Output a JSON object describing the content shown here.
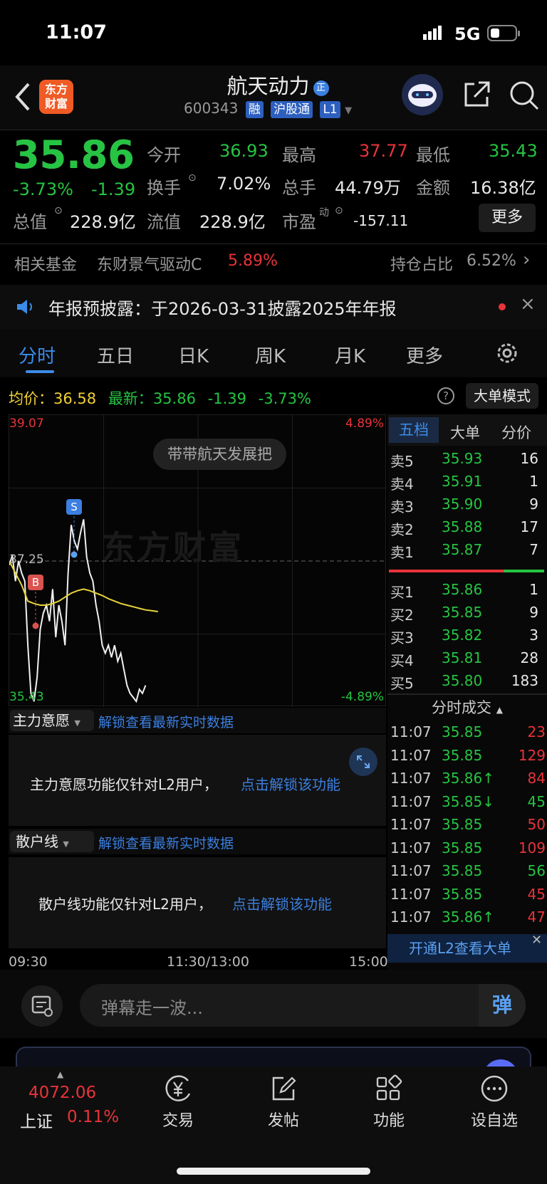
{
  "status": {
    "time": "11:07",
    "network": "5G"
  },
  "header": {
    "name": "航天动力",
    "badge": "正",
    "code": "600343",
    "tags": [
      "融",
      "沪股通",
      "L1"
    ]
  },
  "brand": {
    "logo_line1": "东方",
    "logo_line2": "财富"
  },
  "quote": {
    "price": "35.86",
    "pct": "-3.73%",
    "chg": "-1.39",
    "rows": [
      [
        {
          "k": "今开",
          "v": "36.93",
          "c": "green"
        },
        {
          "k": "最高",
          "v": "37.77",
          "c": "red"
        },
        {
          "k": "最低",
          "v": "35.43",
          "c": "green"
        }
      ],
      [
        {
          "k": "换手",
          "v": "7.02%",
          "c": "white"
        },
        {
          "k": "总手",
          "v": "44.79万",
          "c": "white"
        },
        {
          "k": "金额",
          "v": "16.38亿",
          "c": "white"
        }
      ],
      [
        {
          "k": "总值",
          "v": "228.9亿",
          "c": "white"
        },
        {
          "k": "流值",
          "v": "228.9亿",
          "c": "white"
        },
        {
          "k": "市盈",
          "v": "-157.11",
          "c": "white"
        }
      ]
    ],
    "more": "更多",
    "pe_sup": "动"
  },
  "fund": {
    "label": "相关基金",
    "name": "东财景气驱动C",
    "pct": "5.89%",
    "hold_label": "持仓占比",
    "hold": "6.52%"
  },
  "notice": {
    "text": "年报预披露：于2026-03-31披露2025年年报"
  },
  "tabs": [
    "分时",
    "五日",
    "日K",
    "周K",
    "月K",
    "更多"
  ],
  "info": {
    "avg_label": "均价：",
    "avg": "36.58",
    "last_label": "最新：",
    "last": "35.86",
    "chg": "-1.39",
    "pct": "-3.73%",
    "mode": "大单模式"
  },
  "chart": {
    "top": "39.07",
    "top_pct": "4.89%",
    "mid": "37.25",
    "bottom": "35.43",
    "bottom_pct": "-4.89%",
    "banner": "带带航天发展把",
    "watermark": "东方财富",
    "buy_mark": "B",
    "sell_mark": "S",
    "times": [
      "09:30",
      "11:30/13:00",
      "15:00"
    ]
  },
  "panels": [
    {
      "title": "主力意愿",
      "link": "解锁查看最新实时数据",
      "msg": "主力意愿功能仅针对L2用户，",
      "cta": "点击解锁该功能"
    },
    {
      "title": "散户线",
      "link": "解锁查看最新实时数据",
      "msg": "散户线功能仅针对L2用户，",
      "cta": "点击解锁该功能"
    }
  ],
  "orderbook": {
    "tabs": [
      "五档",
      "大单",
      "分价"
    ],
    "asks": [
      {
        "l": "卖5",
        "p": "35.93",
        "v": "16"
      },
      {
        "l": "卖4",
        "p": "35.91",
        "v": "1"
      },
      {
        "l": "卖3",
        "p": "35.90",
        "v": "9"
      },
      {
        "l": "卖2",
        "p": "35.88",
        "v": "17"
      },
      {
        "l": "卖1",
        "p": "35.87",
        "v": "7"
      }
    ],
    "bids": [
      {
        "l": "买1",
        "p": "35.86",
        "v": "1"
      },
      {
        "l": "买2",
        "p": "35.85",
        "v": "9"
      },
      {
        "l": "买3",
        "p": "35.82",
        "v": "3"
      },
      {
        "l": "买4",
        "p": "35.81",
        "v": "28"
      },
      {
        "l": "买5",
        "p": "35.80",
        "v": "183"
      }
    ],
    "trade_title": "分时成交",
    "trades": [
      {
        "t": "11:07",
        "p": "35.85",
        "v": "23",
        "c": "red"
      },
      {
        "t": "11:07",
        "p": "35.85",
        "v": "129",
        "c": "red"
      },
      {
        "t": "11:07",
        "p": "35.86↑",
        "v": "84",
        "c": "red"
      },
      {
        "t": "11:07",
        "p": "35.85↓",
        "v": "45",
        "c": "green"
      },
      {
        "t": "11:07",
        "p": "35.85",
        "v": "50",
        "c": "red"
      },
      {
        "t": "11:07",
        "p": "35.85",
        "v": "109",
        "c": "red"
      },
      {
        "t": "11:07",
        "p": "35.85",
        "v": "56",
        "c": "green"
      },
      {
        "t": "11:07",
        "p": "35.85",
        "v": "45",
        "c": "red"
      },
      {
        "t": "11:07",
        "p": "35.86↑",
        "v": "47",
        "c": "red"
      }
    ],
    "l2": "开通L2查看大单"
  },
  "comment": {
    "placeholder": "弹幕走一波...",
    "send": "弹"
  },
  "bottom": {
    "index_value": "4072.06",
    "index_name": "上证",
    "index_pct": "0.11%",
    "items": [
      "交易",
      "发帖",
      "功能",
      "设自选"
    ]
  },
  "chart_data": {
    "type": "line",
    "title": "",
    "ylim": [
      35.43,
      39.07
    ],
    "x_ticks": [
      "09:30",
      "11:30/13:00",
      "15:00"
    ],
    "series": [
      {
        "name": "",
        "values": [
          37.2,
          37.32,
          37.0,
          37.25,
          37.1,
          37.0,
          36.2,
          35.6,
          35.5,
          35.8,
          36.4,
          36.6,
          36.7,
          36.5,
          36.9,
          36.3,
          36.7,
          36.5,
          36.2,
          37.1,
          37.7,
          37.5,
          37.4,
          37.6,
          37.77,
          37.3,
          37.1,
          37.0,
          36.7,
          36.5,
          36.2,
          36.1,
          36.2,
          36.05,
          36.2,
          36.0,
          36.1,
          35.9,
          35.7,
          35.6,
          35.55,
          35.5,
          35.65,
          35.6,
          35.7
        ]
      },
      {
        "name": "",
        "values": [
          37.25,
          37.1,
          36.95,
          36.75,
          36.72,
          36.7,
          36.7,
          36.72,
          36.75,
          36.8,
          36.85,
          36.88,
          36.9,
          36.88,
          36.85,
          36.82,
          36.78,
          36.75,
          36.72,
          36.7,
          36.68,
          36.66,
          36.64,
          36.63,
          36.62
        ]
      }
    ]
  }
}
